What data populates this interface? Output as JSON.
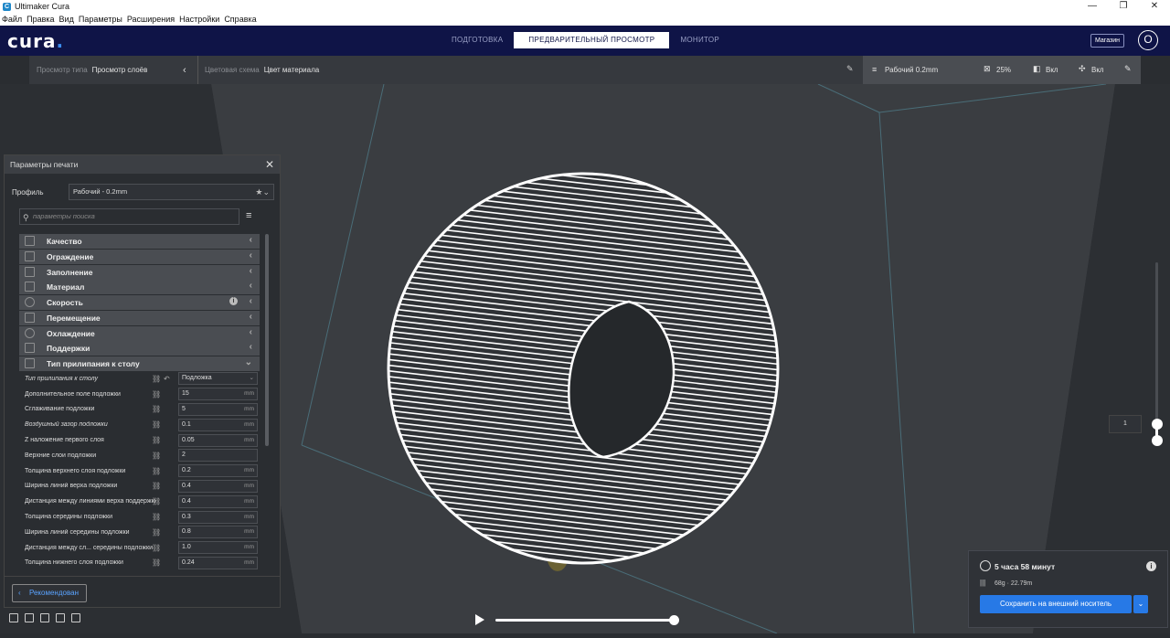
{
  "window": {
    "title": "Ultimaker Cura",
    "controls": [
      "—",
      "❐",
      "✕"
    ]
  },
  "menu": [
    "Файл",
    "Правка",
    "Вид",
    "Параметры",
    "Расширения",
    "Настройки",
    "Справка"
  ],
  "header": {
    "logo": "cura",
    "logo_dot": ".",
    "stages": [
      "ПОДГОТОВКА",
      "ПРЕДВАРИТЕЛЬНЫЙ ПРОСМОТР",
      "МОНИТОР"
    ],
    "active_stage": 1,
    "marketplace": "Магазин",
    "account_initial": "O"
  },
  "viewbar": {
    "view_type_label": "Просмотр типа",
    "view_type_value": "Просмотр слоёв",
    "color_scheme_label": "Цветовая схема",
    "color_scheme_value": "Цвет материала",
    "profile": "Рабочий 0.2mm",
    "infill": "25%",
    "support": "Вкл",
    "adhesion": "Вкл"
  },
  "print_settings": {
    "title": "Параметры печати",
    "profile_label": "Профиль",
    "profile_value": "Рабочий - 0.2mm",
    "search_placeholder": "параметры поиска",
    "categories": [
      {
        "label": "Качество"
      },
      {
        "label": "Ограждение"
      },
      {
        "label": "Заполнение"
      },
      {
        "label": "Материал"
      },
      {
        "label": "Скорость"
      },
      {
        "label": "Перемещение"
      },
      {
        "label": "Охлаждение"
      },
      {
        "label": "Поддержки"
      },
      {
        "label": "Тип прилипания к столу"
      }
    ],
    "settings": [
      {
        "label": "Тип прилипания к столу",
        "value": "Подложка",
        "unit": ""
      },
      {
        "label": "Дополнительное поле подложки",
        "value": "15",
        "unit": "mm"
      },
      {
        "label": "Сглаживание подложки",
        "value": "5",
        "unit": "mm"
      },
      {
        "label": "Воздушный зазор подложки",
        "value": "0.1",
        "unit": "mm"
      },
      {
        "label": "Z наложение первого слоя",
        "value": "0.05",
        "unit": "mm"
      },
      {
        "label": "Верхние слои подложки",
        "value": "2",
        "unit": ""
      },
      {
        "label": "Толщина верхнего слоя подложки",
        "value": "0.2",
        "unit": "mm"
      },
      {
        "label": "Ширина линий верха подложки",
        "value": "0.4",
        "unit": "mm"
      },
      {
        "label": "Дистанция между линиями верха поддержки",
        "value": "0.4",
        "unit": "mm"
      },
      {
        "label": "Толщина середины подложки",
        "value": "0.3",
        "unit": "mm"
      },
      {
        "label": "Ширина линий середины подложки",
        "value": "0.8",
        "unit": "mm"
      },
      {
        "label": "Дистанция между сл... середины подложки",
        "value": "1.0",
        "unit": "mm"
      },
      {
        "label": "Толщина нижнего слоя подложки",
        "value": "0.24",
        "unit": "mm"
      }
    ],
    "recommended_button": "Рекомендован"
  },
  "layer_number": "1",
  "print_info": {
    "time": "5 часа 58 минут",
    "material": "68g · 22.79m",
    "save_button": "Сохранить на внешний носитель"
  },
  "colors": {
    "accent": "#2779e6",
    "header": "#0f1447",
    "viewport": "#2a2d31",
    "build_plate": "#3a3d41"
  }
}
